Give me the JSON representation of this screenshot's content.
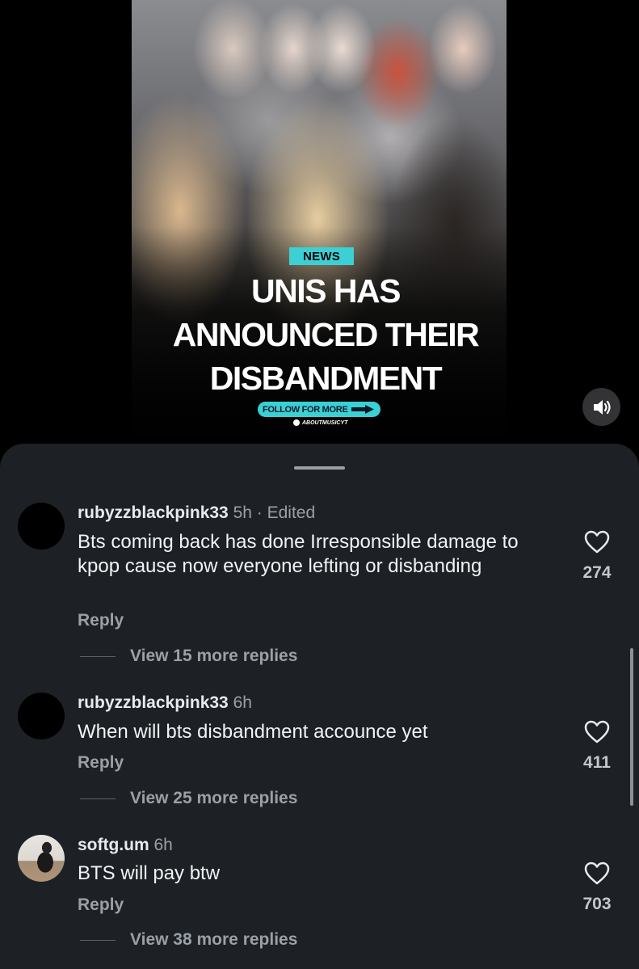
{
  "video": {
    "badge": "NEWS",
    "headline": [
      "UNIS HAS",
      "ANNOUNCED THEIR",
      "DISBANDMENT"
    ],
    "follow_label": "FOLLOW FOR MORE",
    "handle": "ABOUTMUSICYT",
    "sound_icon": "speaker-icon"
  },
  "comments": [
    {
      "username": "rubyzzblackpink33",
      "time": "5h",
      "edited": "· Edited",
      "text": "Bts coming back has done Irresponsible damage to kpop cause now everyone lefting or disbanding",
      "reply_label": "Reply",
      "more_replies": "View 15 more replies",
      "likes": "274",
      "avatar": "black"
    },
    {
      "username": "rubyzzblackpink33",
      "time": "6h",
      "edited": "",
      "text": "When will bts disbandment accounce yet",
      "reply_label": "Reply",
      "more_replies": "View 25 more replies",
      "likes": "411",
      "avatar": "black"
    },
    {
      "username": "softg.um",
      "time": "6h",
      "edited": "",
      "text": "BTS will pay btw",
      "reply_label": "Reply",
      "more_replies": "View 38 more replies",
      "likes": "703",
      "avatar": "photo"
    }
  ],
  "colors": {
    "sheet_bg": "#1d2126",
    "accent_cyan": "#3bd0d4"
  }
}
